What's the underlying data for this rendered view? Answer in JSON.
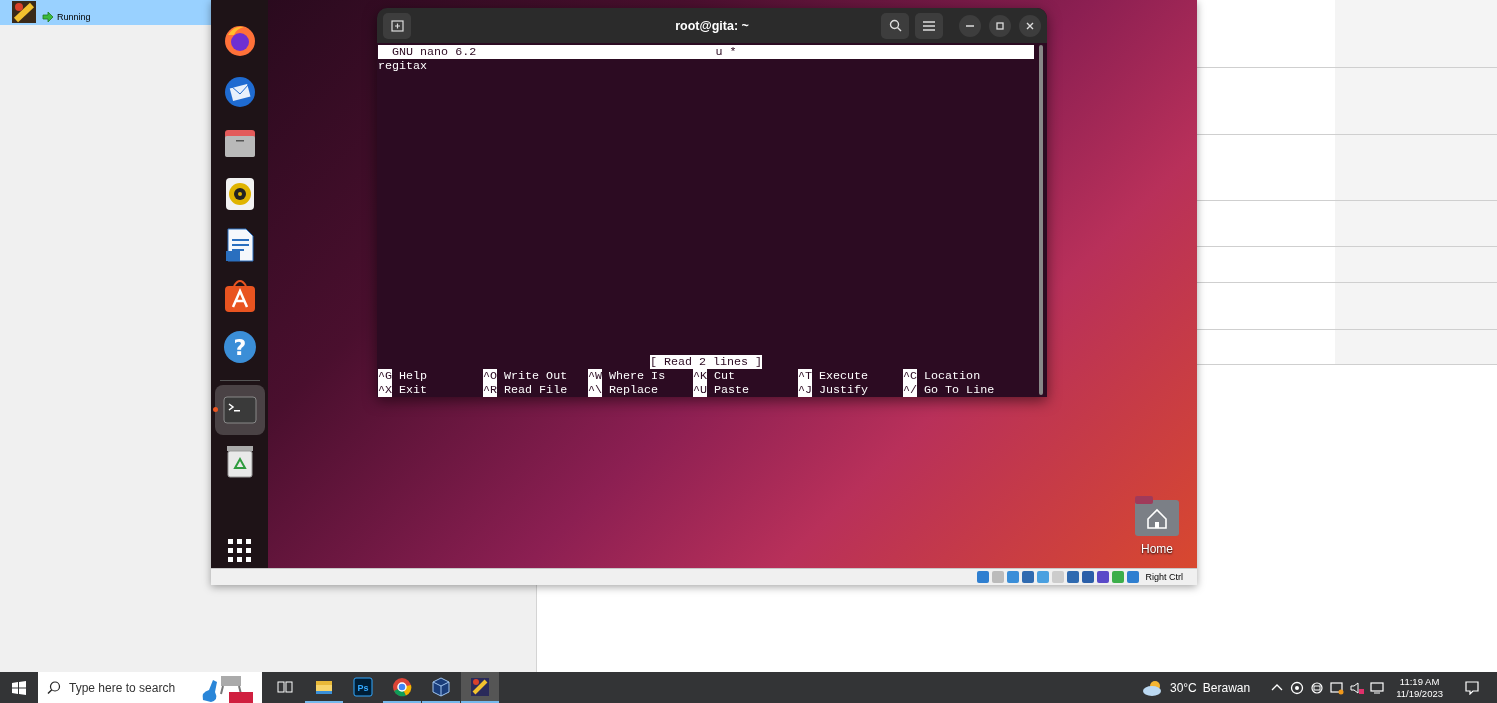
{
  "host": {
    "selected_vm": {
      "status": "Running",
      "selected": true
    }
  },
  "vm": {
    "dock": {
      "items": [
        {
          "kind": "firefox",
          "running": false,
          "selected": false
        },
        {
          "kind": "thunderbird",
          "running": false,
          "selected": false
        },
        {
          "kind": "files",
          "running": false,
          "selected": false
        },
        {
          "kind": "rhythmbox",
          "running": false,
          "selected": false
        },
        {
          "kind": "writer",
          "running": false,
          "selected": false
        },
        {
          "kind": "appcenter",
          "running": false,
          "selected": false
        },
        {
          "kind": "help",
          "glyph": "?",
          "running": false,
          "selected": false
        },
        {
          "kind": "terminal",
          "running": true,
          "selected": true
        },
        {
          "kind": "trash",
          "running": false,
          "selected": false
        }
      ]
    },
    "terminal": {
      "title": "root@gita: ~",
      "nano": {
        "version": "GNU nano 6.2",
        "file": "u *",
        "lines": [
          "regitax"
        ],
        "status": "[ Read 2 lines ]",
        "shortcut_rows": [
          [
            {
              "key": "^G",
              "label": "Help"
            },
            {
              "key": "^O",
              "label": "Write Out"
            },
            {
              "key": "^W",
              "label": "Where Is"
            },
            {
              "key": "^K",
              "label": "Cut"
            },
            {
              "key": "^T",
              "label": "Execute"
            },
            {
              "key": "^C",
              "label": "Location"
            }
          ],
          [
            {
              "key": "^X",
              "label": "Exit"
            },
            {
              "key": "^R",
              "label": "Read File"
            },
            {
              "key": "^\\",
              "label": "Replace"
            },
            {
              "key": "^U",
              "label": "Paste"
            },
            {
              "key": "^J",
              "label": "Justify"
            },
            {
              "key": "^/",
              "label": "Go To Line"
            }
          ]
        ]
      }
    },
    "desktop_icons": [
      {
        "label": "Home"
      }
    ],
    "status_bar": {
      "host_key": "Right Ctrl"
    }
  },
  "taskbar": {
    "search": {
      "placeholder": "Type here to search"
    },
    "apps": [
      {
        "kind": "task-view",
        "running": false,
        "selected": false
      },
      {
        "kind": "file-explorer",
        "running": true,
        "selected": false
      },
      {
        "kind": "photoshop",
        "glyph": "Ps",
        "running": false,
        "selected": false
      },
      {
        "kind": "chrome",
        "running": true,
        "selected": false
      },
      {
        "kind": "virtualbox",
        "running": true,
        "selected": false
      },
      {
        "kind": "app",
        "running": true,
        "selected": true
      }
    ],
    "weather": {
      "temperature": "30°C",
      "condition": "Berawan"
    },
    "clock": {
      "time": "11:19 AM",
      "date": "11/19/2023"
    }
  }
}
